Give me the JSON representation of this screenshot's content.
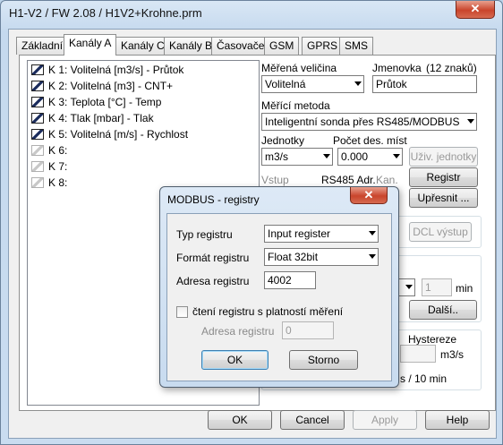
{
  "window": {
    "title": "H1-V2 / FW 2.08 / H1V2+Krohne.prm",
    "close_glyph": "✕"
  },
  "tabs": [
    "Základní",
    "Kanály A",
    "Kanály C",
    "Kanály B",
    "Časovače",
    "GSM",
    "GPRS",
    "SMS"
  ],
  "active_tab": "Kanály A",
  "channels": [
    {
      "label": "K 1: Volitelná [m3/s] - Průtok",
      "enabled": true
    },
    {
      "label": "K 2: Volitelná [m3] - CNT+",
      "enabled": true
    },
    {
      "label": "K 3: Teplota [°C] - Temp",
      "enabled": true
    },
    {
      "label": "K 4: Tlak [mbar] - Tlak",
      "enabled": true
    },
    {
      "label": "K 5: Volitelná [m/s] - Rychlost",
      "enabled": true
    },
    {
      "label": "K 6:",
      "enabled": false
    },
    {
      "label": "K 7:",
      "enabled": false
    },
    {
      "label": "K 8:",
      "enabled": false
    }
  ],
  "settings": {
    "measured_quantity_label": "Měřená veličina",
    "measured_quantity_value": "Volitelná",
    "short_name_label": "Jmenovka",
    "short_name_hint": "(12 znaků)",
    "short_name_value": "Průtok",
    "method_label": "Měřící metoda",
    "method_value": "Inteligentní sonda přes RS485/MODBUS",
    "units_label": "Jednotky",
    "units_value": "m3/s",
    "decimals_label": "Počet des. míst",
    "decimals_value": "0.000",
    "user_units_button": "Uživ. jednotky",
    "input_label": "Vstup",
    "rs485_label": "RS485 Adr.",
    "channel_label": "Kan.",
    "registers_button": "Registr",
    "refine_button": "Upřesnit ...",
    "dcl_button": "DCL výstup",
    "interval_value": "1",
    "interval_unit": "min",
    "next_button": "Další..",
    "hysteresis_label": "Hystereze",
    "hysteresis_unit": "m3/s",
    "rate_fragment": "s / 10 min"
  },
  "footer": {
    "ok": "OK",
    "cancel": "Cancel",
    "apply": "Apply",
    "help": "Help"
  },
  "modal": {
    "title": "MODBUS - registry",
    "close_glyph": "✕",
    "register_type_label": "Typ registru",
    "register_type_value": "Input register",
    "register_format_label": "Formát registru",
    "register_format_value": "Float 32bit",
    "register_address_label": "Adresa registru",
    "register_address_value": "4002",
    "validity_checkbox_label": "čtení registru s platností měření",
    "validity_checked": false,
    "validity_address_label": "Adresa registru",
    "validity_address_value": "0",
    "ok_button": "OK",
    "cancel_button": "Storno"
  }
}
